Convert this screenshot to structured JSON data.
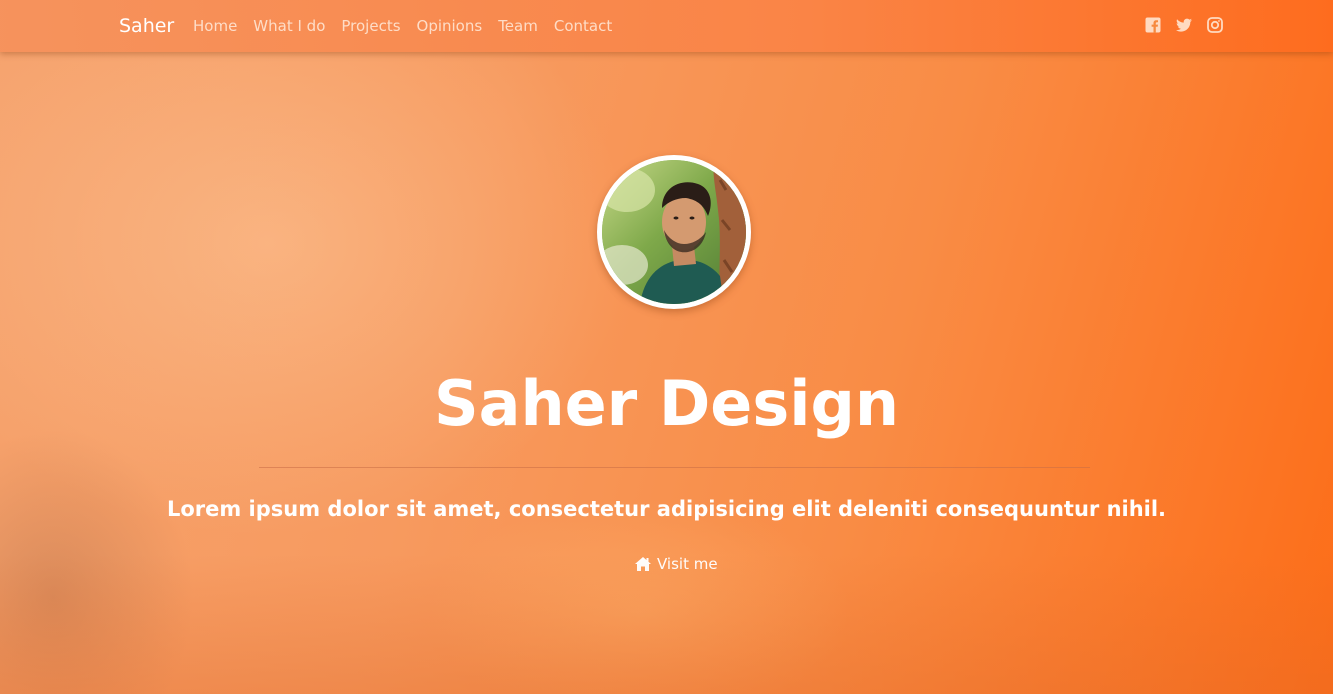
{
  "navbar": {
    "brand": "Saher",
    "links": [
      {
        "label": "Home"
      },
      {
        "label": "What I do"
      },
      {
        "label": "Projects"
      },
      {
        "label": "Opinions"
      },
      {
        "label": "Team"
      },
      {
        "label": "Contact"
      }
    ],
    "social_icons": [
      "facebook-icon",
      "twitter-icon",
      "instagram-icon"
    ]
  },
  "hero": {
    "title": "Saher Design",
    "subtitle": "Lorem ipsum dolor sit amet, consectetur adipisicing elit deleniti consequuntur nihil.",
    "cta_label": "Visit me",
    "cta_icon": "home-icon"
  },
  "colors": {
    "background_accent": "#fd6d18",
    "background_light": "#f6a36e",
    "text": "#ffffff"
  }
}
